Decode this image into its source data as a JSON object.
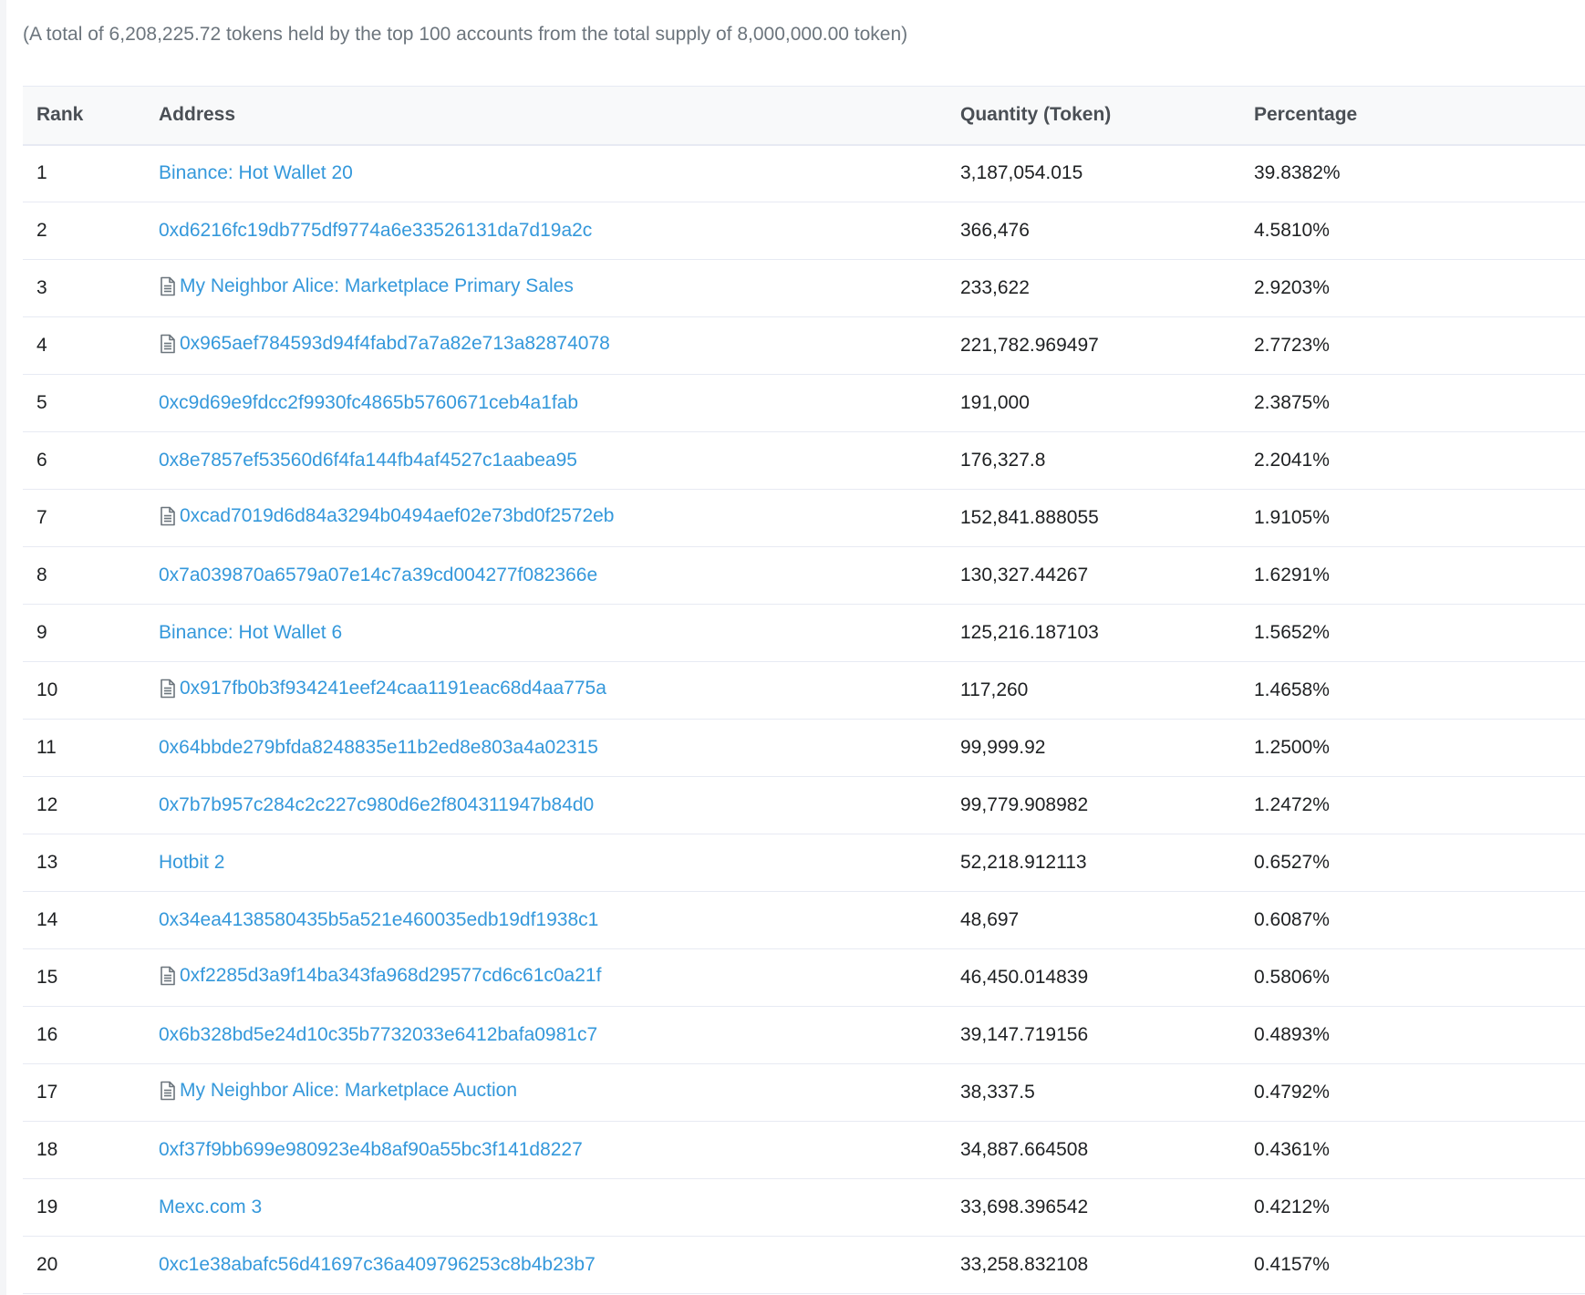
{
  "summary": "(A total of 6,208,225.72 tokens held by the top 100 accounts from the total supply of 8,000,000.00 token)",
  "table": {
    "headers": {
      "rank": "Rank",
      "address": "Address",
      "quantity": "Quantity (Token)",
      "percentage": "Percentage"
    },
    "rows": [
      {
        "rank": "1",
        "address": "Binance: Hot Wallet 20",
        "contract": false,
        "quantity": "3,187,054.015",
        "percentage": "39.8382%"
      },
      {
        "rank": "2",
        "address": "0xd6216fc19db775df9774a6e33526131da7d19a2c",
        "contract": false,
        "quantity": "366,476",
        "percentage": "4.5810%"
      },
      {
        "rank": "3",
        "address": "My Neighbor Alice: Marketplace Primary Sales",
        "contract": true,
        "quantity": "233,622",
        "percentage": "2.9203%"
      },
      {
        "rank": "4",
        "address": "0x965aef784593d94f4fabd7a7a82e713a82874078",
        "contract": true,
        "quantity": "221,782.969497",
        "percentage": "2.7723%"
      },
      {
        "rank": "5",
        "address": "0xc9d69e9fdcc2f9930fc4865b5760671ceb4a1fab",
        "contract": false,
        "quantity": "191,000",
        "percentage": "2.3875%"
      },
      {
        "rank": "6",
        "address": "0x8e7857ef53560d6f4fa144fb4af4527c1aabea95",
        "contract": false,
        "quantity": "176,327.8",
        "percentage": "2.2041%"
      },
      {
        "rank": "7",
        "address": "0xcad7019d6d84a3294b0494aef02e73bd0f2572eb",
        "contract": true,
        "quantity": "152,841.888055",
        "percentage": "1.9105%"
      },
      {
        "rank": "8",
        "address": "0x7a039870a6579a07e14c7a39cd004277f082366e",
        "contract": false,
        "quantity": "130,327.44267",
        "percentage": "1.6291%"
      },
      {
        "rank": "9",
        "address": "Binance: Hot Wallet 6",
        "contract": false,
        "quantity": "125,216.187103",
        "percentage": "1.5652%"
      },
      {
        "rank": "10",
        "address": "0x917fb0b3f934241eef24caa1191eac68d4aa775a",
        "contract": true,
        "quantity": "117,260",
        "percentage": "1.4658%"
      },
      {
        "rank": "11",
        "address": "0x64bbde279bfda8248835e11b2ed8e803a4a02315",
        "contract": false,
        "quantity": "99,999.92",
        "percentage": "1.2500%"
      },
      {
        "rank": "12",
        "address": "0x7b7b957c284c2c227c980d6e2f804311947b84d0",
        "contract": false,
        "quantity": "99,779.908982",
        "percentage": "1.2472%"
      },
      {
        "rank": "13",
        "address": "Hotbit 2",
        "contract": false,
        "quantity": "52,218.912113",
        "percentage": "0.6527%"
      },
      {
        "rank": "14",
        "address": "0x34ea4138580435b5a521e460035edb19df1938c1",
        "contract": false,
        "quantity": "48,697",
        "percentage": "0.6087%"
      },
      {
        "rank": "15",
        "address": "0xf2285d3a9f14ba343fa968d29577cd6c61c0a21f",
        "contract": true,
        "quantity": "46,450.014839",
        "percentage": "0.5806%"
      },
      {
        "rank": "16",
        "address": "0x6b328bd5e24d10c35b7732033e6412bafa0981c7",
        "contract": false,
        "quantity": "39,147.719156",
        "percentage": "0.4893%"
      },
      {
        "rank": "17",
        "address": "My Neighbor Alice: Marketplace Auction",
        "contract": true,
        "quantity": "38,337.5",
        "percentage": "0.4792%"
      },
      {
        "rank": "18",
        "address": "0xf37f9bb699e980923e4b8af90a55bc3f141d8227",
        "contract": false,
        "quantity": "34,887.664508",
        "percentage": "0.4361%"
      },
      {
        "rank": "19",
        "address": "Mexc.com 3",
        "contract": false,
        "quantity": "33,698.396542",
        "percentage": "0.4212%"
      },
      {
        "rank": "20",
        "address": "0xc1e38abafc56d41697c36a409796253c8b4b23b7",
        "contract": false,
        "quantity": "33,258.832108",
        "percentage": "0.4157%"
      }
    ]
  },
  "colors": {
    "link": "#3498db",
    "muted_text": "#6c757d",
    "header_bg": "#f8f9fa",
    "border": "#e7eaf3"
  },
  "icons": {
    "contract": "file-document-icon"
  }
}
